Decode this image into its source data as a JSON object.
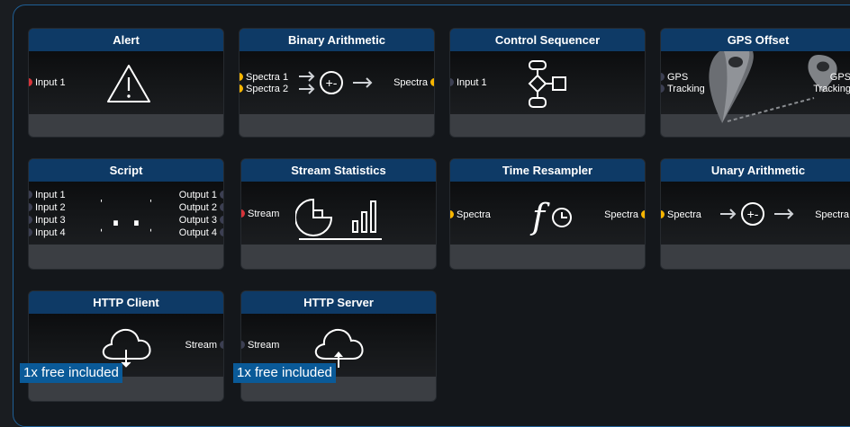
{
  "cards": {
    "alert": {
      "title": "Alert",
      "in1": "Input 1"
    },
    "binary": {
      "title": "Binary Arithmetic",
      "in1": "Spectra 1",
      "in2": "Spectra 2",
      "out": "Spectra"
    },
    "control": {
      "title": "Control Sequencer",
      "in1": "Input 1"
    },
    "gps": {
      "title": "GPS Offset",
      "in_a": "GPS",
      "in_b": "Tracking",
      "out_a": "GPS",
      "out_b": "Tracking"
    },
    "script": {
      "title": "Script",
      "inputs": [
        "Input 1",
        "Input 2",
        "Input 3",
        "Input 4"
      ],
      "outputs": [
        "Output 1",
        "Output 2",
        "Output 3",
        "Output 4"
      ]
    },
    "stats": {
      "title": "Stream Statistics",
      "in1": "Stream"
    },
    "resampler": {
      "title": "Time Resampler",
      "in1": "Spectra",
      "out": "Spectra"
    },
    "unary": {
      "title": "Unary Arithmetic",
      "in1": "Spectra",
      "out": "Spectra"
    },
    "http_client": {
      "title": "HTTP Client",
      "out": "Stream",
      "badge": "1x free included"
    },
    "http_server": {
      "title": "HTTP Server",
      "in1": "Stream",
      "badge": "1x free included"
    }
  },
  "colors": {
    "header": "#0e3a66",
    "frame": "#1f5f96",
    "red_port": "#d6343a",
    "yellow_port": "#f7b500",
    "gray_port": "#3c3f52",
    "badge": "#0a5a98"
  },
  "icons": {
    "alert": "warning-triangle-icon",
    "binary": "plus-minus-arithmetic-icon",
    "control": "flowchart-icon",
    "gps": "map-pin-icon",
    "script": "braces-icon",
    "stats": "pie-bar-chart-icon",
    "resampler": "function-clock-icon",
    "unary": "plus-minus-arithmetic-icon",
    "http_client": "cloud-download-icon",
    "http_server": "cloud-upload-icon"
  }
}
